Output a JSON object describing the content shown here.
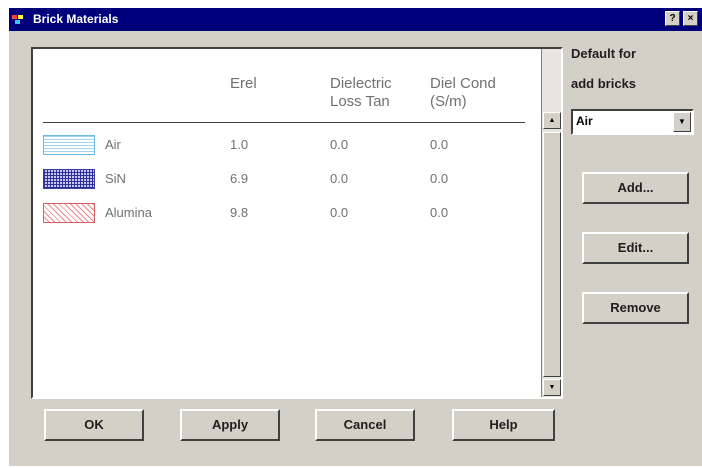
{
  "window": {
    "title": "Brick Materials",
    "help_button": "?",
    "close_button": "×"
  },
  "table": {
    "headers": {
      "erel": "Erel",
      "loss_line1": "Dielectric",
      "loss_line2": "Loss Tan",
      "cond_line1": "Diel Cond",
      "cond_line2": "(S/m)"
    },
    "rows": [
      {
        "name": "Air",
        "erel": "1.0",
        "loss": "0.0",
        "cond": "0.0",
        "swatch": "light-blue-lines"
      },
      {
        "name": "SiN",
        "erel": "6.9",
        "loss": "0.0",
        "cond": "0.0",
        "swatch": "dark-blue-grid"
      },
      {
        "name": "Alumina",
        "erel": "9.8",
        "loss": "0.0",
        "cond": "0.0",
        "swatch": "red-diagonal"
      }
    ]
  },
  "default": {
    "label_line1": "Default for",
    "label_line2": "add bricks",
    "value": "Air"
  },
  "side_buttons": {
    "add": "Add...",
    "edit": "Edit...",
    "remove": "Remove"
  },
  "bottom_buttons": {
    "ok": "OK",
    "apply": "Apply",
    "cancel": "Cancel",
    "help": "Help"
  },
  "colors": {
    "titlebar": "#00007b",
    "face": "#d4d0c8",
    "text_gray": "#707070"
  }
}
